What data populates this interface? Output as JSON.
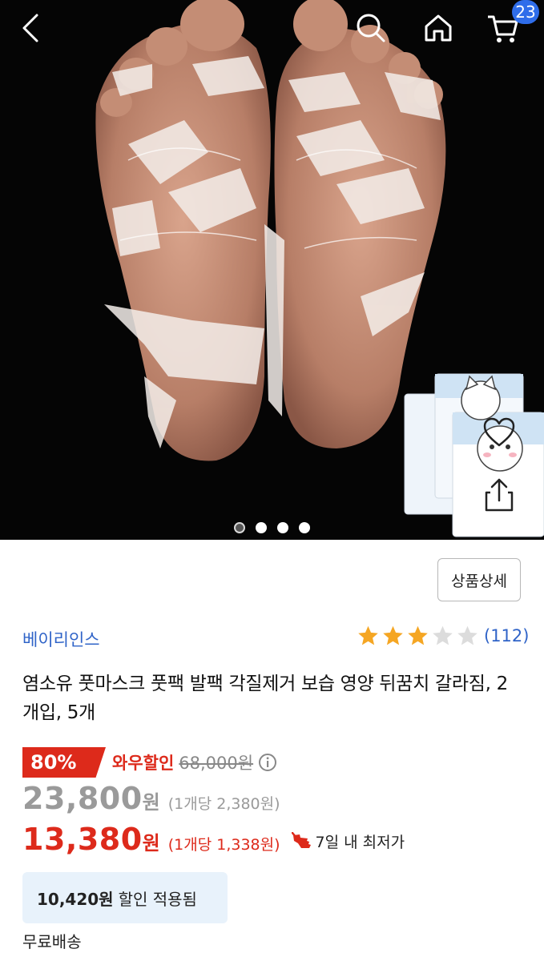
{
  "header": {
    "cart_count": "23",
    "icons": [
      "back-arrow-icon",
      "search-icon",
      "home-icon",
      "cart-icon"
    ]
  },
  "gallery": {
    "image": "foot-peel-mask-photo",
    "product_thumbnail": "cat-character-foot-mask-packages",
    "page_count": 4,
    "active_page": 1,
    "icons": [
      "heart-icon",
      "share-icon"
    ]
  },
  "details_button": "상품상세",
  "brand": "베이리인스",
  "rating": {
    "filled_stars": 3,
    "max_stars": 5,
    "count": "(112)",
    "star_color": "#f5a623"
  },
  "title": "염소유 풋마스크 풋팩 발팩 각질제거 보습 영양 뒤꿈치 갈라짐, 2개입, 5개",
  "discount": {
    "percent": "80%",
    "label": "와우할인",
    "original_price": "68,000원"
  },
  "price_regular": {
    "amount": "23,800",
    "currency": "원",
    "unit_price": "(1개당 2,380원)"
  },
  "price_sale": {
    "amount": "13,380",
    "currency": "원",
    "unit_price": "(1개당 1,338원)",
    "lowest_label": "7일 내 최저가"
  },
  "applied_discount": {
    "amount": "10,420원",
    "label": "할인 적용됨"
  },
  "shipping": "무료배송",
  "colors": {
    "sale_red": "#dd2a1b",
    "link_blue": "#3064c8",
    "badge_blue": "#2f6dea",
    "applied_bg": "#e8f2fb"
  }
}
